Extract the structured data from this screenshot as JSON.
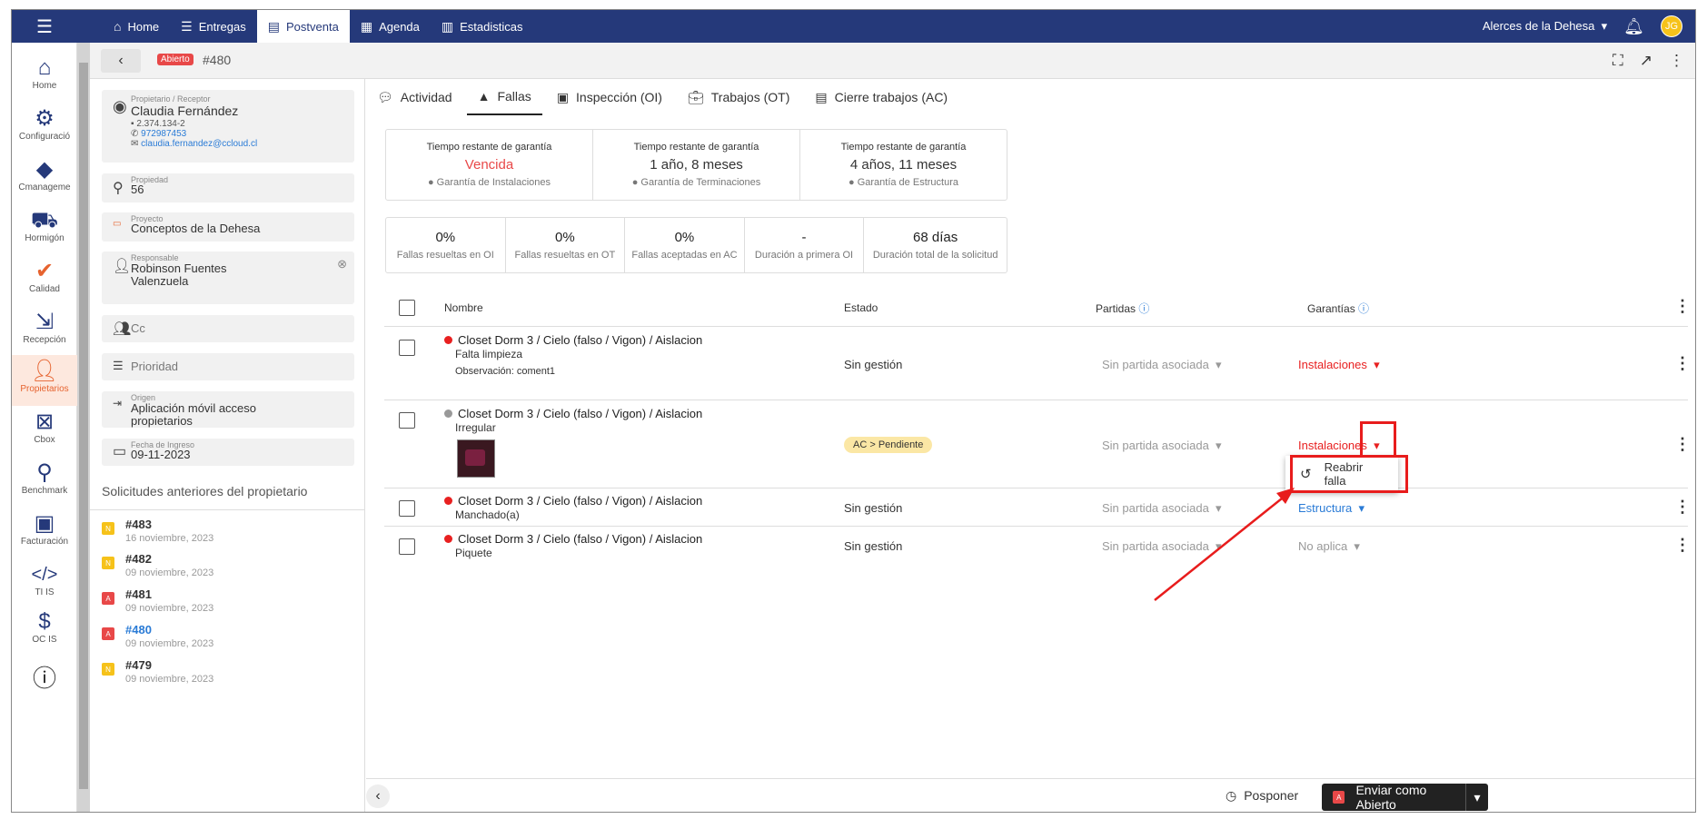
{
  "topbar": {
    "nav": [
      {
        "icon": "home-icon",
        "label": "Home"
      },
      {
        "icon": "list-icon",
        "label": "Entregas"
      },
      {
        "icon": "document-icon",
        "label": "Postventa"
      },
      {
        "icon": "calendar-icon",
        "label": "Agenda"
      },
      {
        "icon": "chart-icon",
        "label": "Estadisticas"
      }
    ],
    "project": "Alerces de la Dehesa",
    "avatar": "JG"
  },
  "sidebar": [
    {
      "label": "Home",
      "icon": "home-outline-icon"
    },
    {
      "label": "Configuració",
      "icon": "gear-icon"
    },
    {
      "label": "Cmanageme",
      "icon": "cmanagement-icon"
    },
    {
      "label": "Hormigón",
      "icon": "wheelbarrow-icon"
    },
    {
      "label": "Calidad",
      "icon": "quality-check-icon"
    },
    {
      "label": "Recepción",
      "icon": "reception-icon"
    },
    {
      "label": "Propietarios",
      "icon": "owners-icon"
    },
    {
      "label": "Cbox",
      "icon": "cbox-icon"
    },
    {
      "label": "Benchmark",
      "icon": "benchmark-icon"
    },
    {
      "label": "Facturación",
      "icon": "invoice-icon"
    },
    {
      "label": "TI IS",
      "icon": "code-icon"
    },
    {
      "label": "OC IS",
      "icon": "dollar-icon"
    }
  ],
  "subbar": {
    "status": "Abierto",
    "ticket": "#480"
  },
  "owner": {
    "label": "Propietario / Receptor",
    "name": "Claudia Fernández",
    "rut": "2.374.134-2",
    "phone": "972987453",
    "email": "claudia.fernandez@ccloud.cl"
  },
  "property": {
    "label": "Propiedad",
    "value": "56"
  },
  "project": {
    "label": "Proyecto",
    "value": "Conceptos de la Dehesa"
  },
  "responsible": {
    "label": "Responsable",
    "value_line1": "Robinson Fuentes",
    "value_line2": "Valenzuela"
  },
  "cc": {
    "placeholder": "Cc"
  },
  "priority": {
    "placeholder": "Prioridad"
  },
  "origin": {
    "label": "Origen",
    "value_line1": "Aplicación móvil acceso",
    "value_line2": "propietarios"
  },
  "date_in": {
    "label": "Fecha de Ingreso",
    "value": "09-11-2023"
  },
  "previous": {
    "title": "Solicitudes anteriores del propietario",
    "items": [
      {
        "badge": "N",
        "color": "#f6c21a",
        "num": "#483",
        "date": "16 noviembre, 2023"
      },
      {
        "badge": "N",
        "color": "#f6c21a",
        "num": "#482",
        "date": "09 noviembre, 2023"
      },
      {
        "badge": "A",
        "color": "#e84848",
        "num": "#481",
        "date": "09 noviembre, 2023"
      },
      {
        "badge": "A",
        "color": "#e84848",
        "num": "#480",
        "date": "09 noviembre, 2023"
      },
      {
        "badge": "N",
        "color": "#f6c21a",
        "num": "#479",
        "date": "09 noviembre, 2023"
      }
    ]
  },
  "tabs": [
    {
      "label": "Actividad",
      "icon": "chat-icon"
    },
    {
      "label": "Fallas",
      "icon": "warning-icon"
    },
    {
      "label": "Inspección (OI)",
      "icon": "inspection-icon"
    },
    {
      "label": "Trabajos (OT)",
      "icon": "briefcase-icon"
    },
    {
      "label": "Cierre trabajos (AC)",
      "icon": "checklist-icon"
    }
  ],
  "warranty": [
    {
      "label": "Tiempo restante de garantía",
      "value": "Vencida",
      "sub": "Garantía de Instalaciones"
    },
    {
      "label": "Tiempo restante de garantía",
      "value": "1 año, 8 meses",
      "sub": "Garantía de Terminaciones"
    },
    {
      "label": "Tiempo restante de garantía",
      "value": "4 años, 11 meses",
      "sub": "Garantía de Estructura"
    }
  ],
  "stats": [
    {
      "value": "0%",
      "label": "Fallas resueltas en OI"
    },
    {
      "value": "0%",
      "label": "Fallas resueltas en OT"
    },
    {
      "value": "0%",
      "label": "Fallas aceptadas en AC"
    },
    {
      "value": "-",
      "label": "Duración a primera OI"
    },
    {
      "value": "68 días",
      "label": "Duración total de la solicitud"
    }
  ],
  "table": {
    "headers": {
      "name": "Nombre",
      "estado": "Estado",
      "partidas": "Partidas",
      "garantias": "Garantías"
    },
    "rows": [
      {
        "title": "Closet Dorm 3 / Cielo (falso / Vigon) / Aislacion",
        "sub": "Falta limpieza",
        "obs": "Observación: coment1",
        "estado": "Sin gestión",
        "partida": "Sin partida asociada",
        "garantia": "Instalaciones",
        "dot": "#e82020",
        "garColor": "#e82020"
      },
      {
        "title": "Closet Dorm 3 / Cielo (falso / Vigon) / Aislacion",
        "sub": "Irregular",
        "estado": "AC > Pendiente",
        "partida": "Sin partida asociada",
        "garantia": "Instalaciones",
        "dot": "#999999",
        "garColor": "#e82020"
      },
      {
        "title": "Closet Dorm 3 / Cielo (falso / Vigon) / Aislacion",
        "sub": "Manchado(a)",
        "estado": "Sin gestión",
        "partida": "Sin partida asociada",
        "garantia": "Estructura",
        "dot": "#e82020",
        "garColor": "#2a7bd6"
      },
      {
        "title": "Closet Dorm 3 / Cielo (falso / Vigon) / Aislacion",
        "sub": "Piquete",
        "estado": "Sin gestión",
        "partida": "Sin partida asociada",
        "garantia": "No aplica",
        "dot": "#e82020",
        "garColor": "#999999"
      }
    ]
  },
  "context_menu": {
    "item": "Reabrir falla"
  },
  "bottom": {
    "posponer": "Posponer",
    "send": "Enviar como Abierto",
    "send_badge": "A"
  }
}
